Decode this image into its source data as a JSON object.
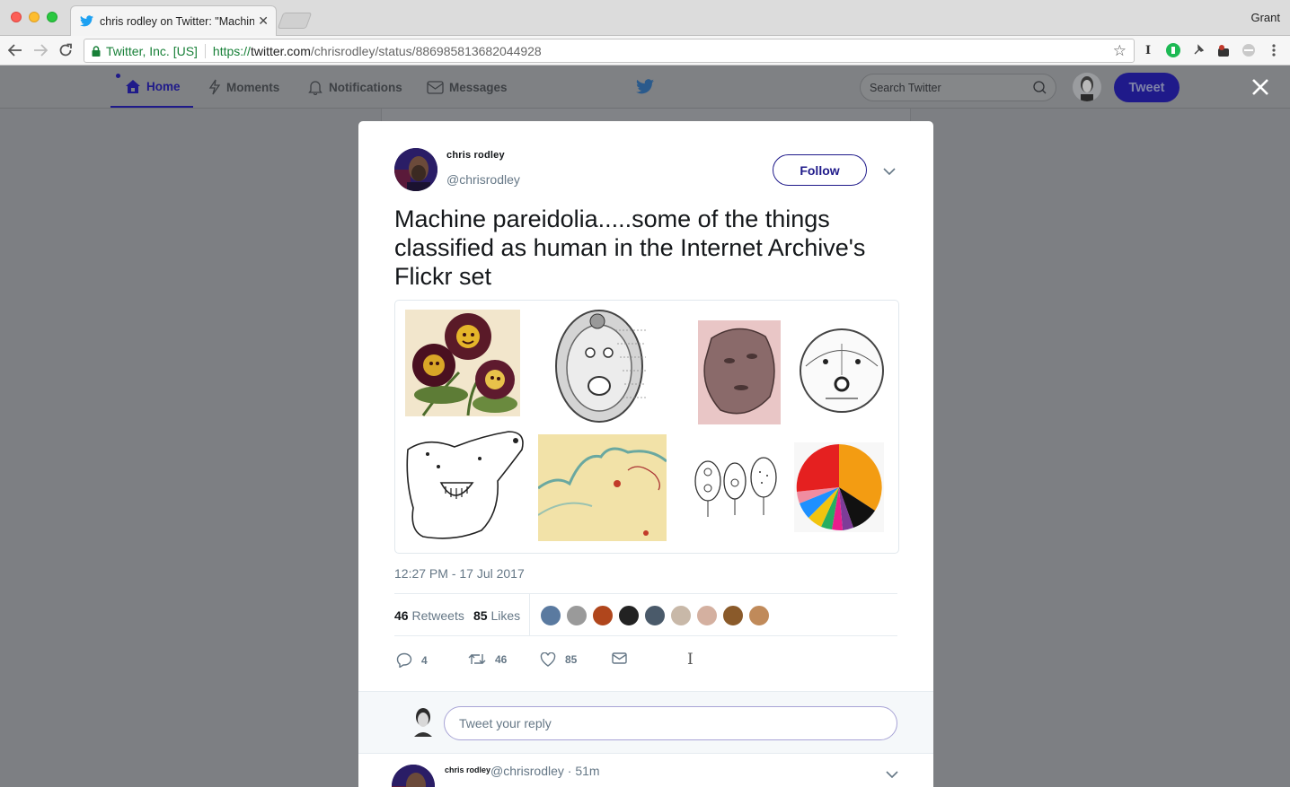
{
  "browser": {
    "tab_title": "chris rodley on Twitter: \"Machine p",
    "tab_close": "✕",
    "profile": "Grant",
    "secure_label": "Twitter, Inc. [US]",
    "url_scheme": "https://",
    "url_host": "twitter.com",
    "url_path": "/chrisrodley/status/886985813682044928"
  },
  "twitter_nav": {
    "home": "Home",
    "moments": "Moments",
    "notifications": "Notifications",
    "messages": "Messages",
    "search_placeholder": "Search Twitter",
    "tweet_button": "Tweet"
  },
  "tweet": {
    "author_name": "chris rodley",
    "author_handle": "@chrisrodley",
    "follow_label": "Follow",
    "text": "Machine pareidolia.....some of the things classified as human in the Internet Archive's Flickr set",
    "timestamp": "12:27 PM - 17 Jul 2017",
    "retweets_count": "46",
    "retweets_label": "Retweets",
    "likes_count": "85",
    "likes_label": "Likes",
    "actions": {
      "reply_count": "4",
      "retweet_count": "46",
      "like_count": "85"
    }
  },
  "reply_box": {
    "placeholder": "Tweet your reply"
  },
  "next_reply": {
    "author_name": "chris rodley",
    "meta": "@chrisrodley · 51m"
  },
  "colors": {
    "accent": "#1f1a8a",
    "link_grey": "#657786",
    "secure_green": "#188038"
  }
}
